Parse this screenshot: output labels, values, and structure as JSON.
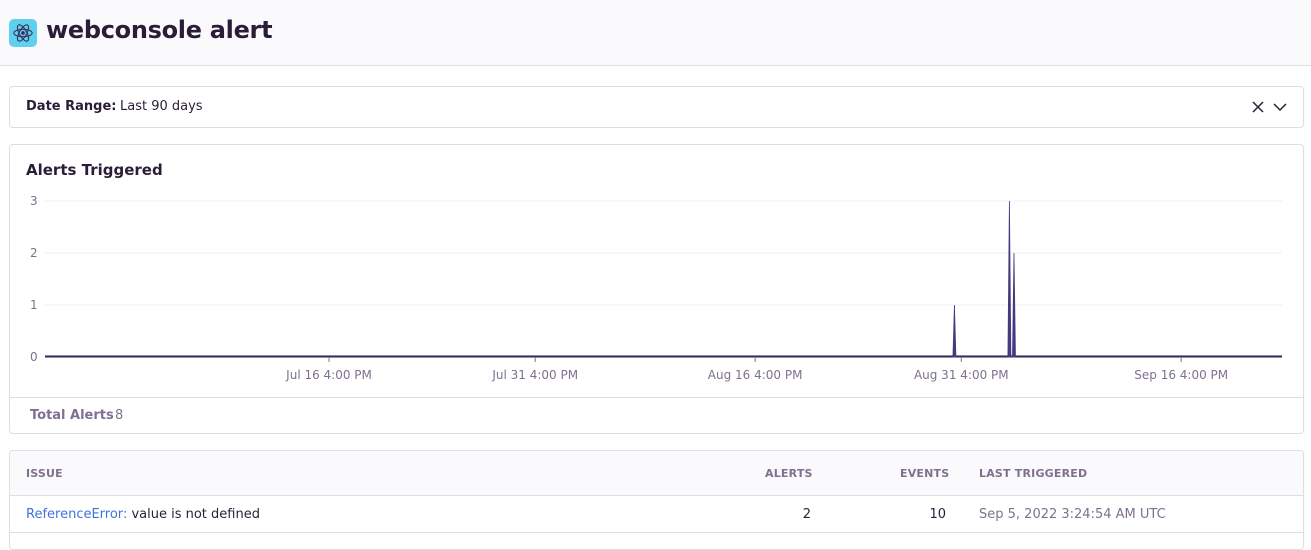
{
  "header": {
    "title": "webconsole alert",
    "logo_icon": "react-logo-icon",
    "logo_color": "#5fd1ee"
  },
  "date_range": {
    "label": "Date Range:",
    "value": "Last 90 days",
    "clear_icon": "close-icon",
    "open_icon": "chevron-down-icon"
  },
  "alerts_chart": {
    "title": "Alerts Triggered",
    "total_label": "Total Alerts",
    "total_value": "8"
  },
  "chart_data": {
    "type": "area",
    "title": "Alerts Triggered",
    "xlabel": "",
    "ylabel": "",
    "ylim": [
      0,
      3
    ],
    "y_ticks": [
      "0",
      "1",
      "2",
      "3"
    ],
    "x_ticks": [
      "Jul 16 4:00 PM",
      "Jul 31 4:00 PM",
      "Aug 16 4:00 PM",
      "Aug 31 4:00 PM",
      "Sep 16 4:00 PM"
    ],
    "x_range": [
      "Jun 26 2022",
      "Sep 24 2022"
    ],
    "points": [
      {
        "x": "Aug 31 2022 04:00 AM",
        "y": 1
      },
      {
        "x": "Sep 4 2022 04:00 AM",
        "y": 3
      },
      {
        "x": "Sep 4 2022 12:00 PM",
        "y": 2
      }
    ],
    "color": "#443a7f",
    "grid": true
  },
  "issues_table": {
    "columns": {
      "issue": "ISSUE",
      "alerts": "ALERTS",
      "events": "EVENTS",
      "last_triggered": "LAST TRIGGERED"
    },
    "rows": [
      {
        "issue_type": "ReferenceError",
        "issue_sep": ":",
        "issue_message": " value is not defined",
        "alerts": "2",
        "events": "10",
        "last_triggered": "Sep 5, 2022 3:24:54 AM UTC"
      }
    ]
  }
}
